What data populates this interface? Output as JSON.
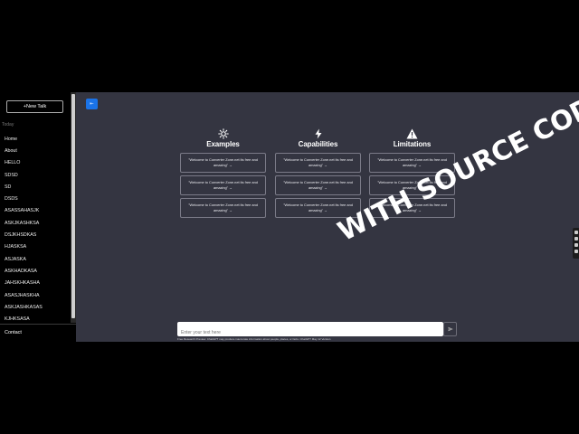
{
  "sidebar": {
    "new_talk_label": "+New Talk",
    "section_label": "Today",
    "items": [
      {
        "label": "Home"
      },
      {
        "label": "About"
      },
      {
        "label": "HELLO"
      },
      {
        "label": "SDSD"
      },
      {
        "label": "SD"
      },
      {
        "label": "DSDS"
      },
      {
        "label": "ASASSAHASJK"
      },
      {
        "label": "ASKJKASHKSA"
      },
      {
        "label": "DSJKHSDKAS"
      },
      {
        "label": "HJASKSA"
      },
      {
        "label": "ASJASKA"
      },
      {
        "label": "ASKHADKASA"
      },
      {
        "label": "JAHSKHKASHA"
      },
      {
        "label": "ASASJHASKHA"
      },
      {
        "label": "ASKJASHKASAS"
      },
      {
        "label": "KJHKSASA"
      }
    ],
    "contact_label": "Contact"
  },
  "main": {
    "toggle_label": "⇤",
    "columns": [
      {
        "icon": "sun-icon",
        "title": "Examples",
        "cards": [
          "\"Welcome to Converter Zone.net its free and amazing\" →",
          "\"Welcome to Converter Zone.net its free and amazing\" →",
          "\"Welcome to Converter Zone.net its free and amazing\" →"
        ]
      },
      {
        "icon": "lightning-icon",
        "title": "Capabilities",
        "cards": [
          "\"Welcome to Converter Zone.net its free and amazing\" →",
          "\"Welcome to Converter Zone.net its free and amazing\" →",
          "\"Welcome to Converter Zone.net its free and amazing\" →"
        ]
      },
      {
        "icon": "warning-icon",
        "title": "Limitations",
        "cards": [
          "\"Welcome to Converter Zone.net its free and amazing\" →",
          "\"Welcome to Converter Zone.net its free and amazing\" →",
          "\"Welcome to Converter Zone.net its free and amazing\" →"
        ]
      }
    ],
    "input_placeholder": "Enter your text here",
    "footer": "Free Research Preview. ChatGPT may produce inaccurate information about people, places, or facts. ChatGPT May 12 Version"
  },
  "overlay_text": "WITH SOURCE CODE",
  "colors": {
    "background": "#000000",
    "main_bg": "#343541",
    "accent": "#1a73e8"
  }
}
